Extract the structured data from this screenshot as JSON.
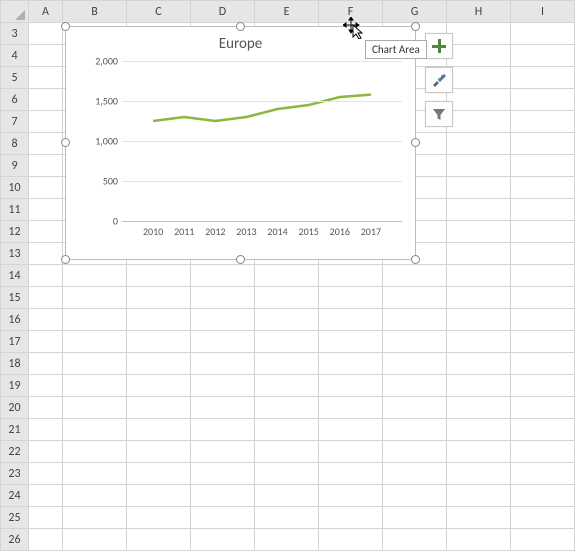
{
  "columns": [
    "A",
    "B",
    "C",
    "D",
    "E",
    "F",
    "G",
    "H",
    "I"
  ],
  "rows": [
    "3",
    "4",
    "5",
    "6",
    "7",
    "8",
    "9",
    "10",
    "11",
    "12",
    "13",
    "14",
    "15",
    "16",
    "17",
    "18",
    "19",
    "20",
    "21",
    "22",
    "23",
    "24",
    "25",
    "26"
  ],
  "tooltip": "Chart Area",
  "chart_data": {
    "type": "line",
    "title": "Europe",
    "xlabel": "",
    "ylabel": "",
    "ylim": [
      0,
      2000
    ],
    "yticks": [
      0,
      500,
      1000,
      1500,
      2000
    ],
    "ytick_labels": [
      "0",
      "500",
      "1,000",
      "1,500",
      "2,000"
    ],
    "categories": [
      "2010",
      "2011",
      "2012",
      "2013",
      "2014",
      "2015",
      "2016",
      "2017"
    ],
    "series": [
      {
        "name": "Europe",
        "color": "#8fb63f",
        "values": [
          1250,
          1300,
          1250,
          1300,
          1400,
          1450,
          1550,
          1580
        ]
      }
    ]
  },
  "buttons": {
    "plus": "plus-icon",
    "brush": "brush-icon",
    "filter": "filter-icon"
  }
}
